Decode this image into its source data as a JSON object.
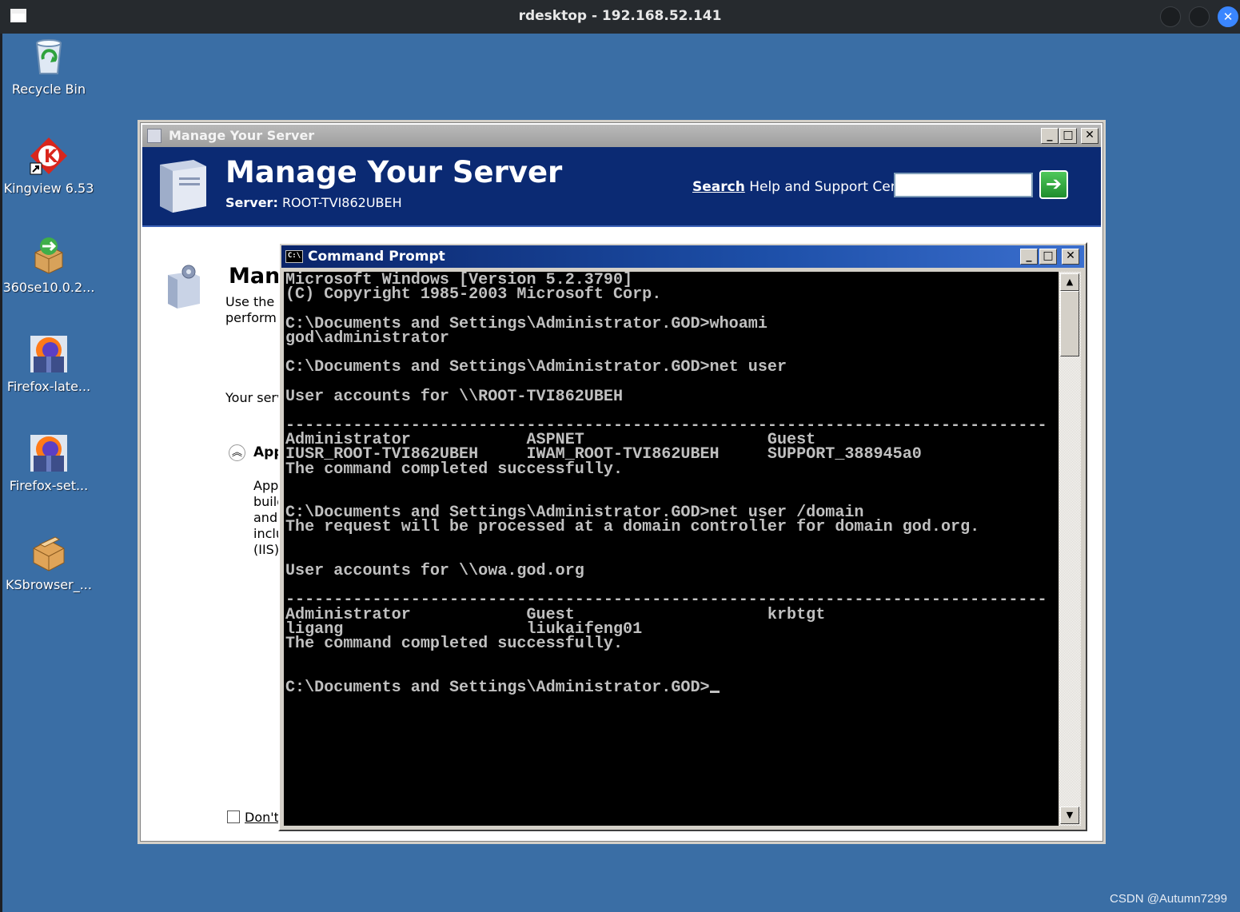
{
  "host": {
    "title": "rdesktop - 192.168.52.141",
    "close_glyph": "✕"
  },
  "desktop_icons": [
    {
      "label": "Recycle Bin",
      "icon": "recycle-bin-icon"
    },
    {
      "label": "Kingview 6.53",
      "icon": "kingview-icon"
    },
    {
      "label": "360se10.0.2...",
      "icon": "package-installer-icon"
    },
    {
      "label": "Firefox-late...",
      "icon": "firefox-installer-icon"
    },
    {
      "label": "Firefox-set...",
      "icon": "firefox-installer-icon"
    },
    {
      "label": "KSbrowser_...",
      "icon": "package-installer-icon"
    }
  ],
  "manage_server": {
    "window_title": "Manage Your Server",
    "heading": "Manage Your Server",
    "server_label": "Server:",
    "server_name": "ROOT-TVI862UBEH",
    "search_label_bold": "Search",
    "search_label_rest": " Help and Support Center",
    "search_value": "",
    "go_glyph": "➔",
    "content_heading": "Mana",
    "content_line1": "Use the t",
    "content_line2": "perform y",
    "your_server": "Your serv",
    "roles_heading": "App",
    "roles_lines": [
      "Appl",
      "build",
      "and",
      "inclu",
      "(IIS)"
    ],
    "dont_show": "Don't"
  },
  "cmd": {
    "window_title": "Command Prompt",
    "icon_text": "C:\\",
    "lines": [
      "Microsoft Windows [Version 5.2.3790]",
      "(C) Copyright 1985-2003 Microsoft Corp.",
      "",
      "C:\\Documents and Settings\\Administrator.GOD>whoami",
      "god\\administrator",
      "",
      "C:\\Documents and Settings\\Administrator.GOD>net user",
      "",
      "User accounts for \\\\ROOT-TVI862UBEH",
      "",
      "-------------------------------------------------------------------------------",
      "Administrator            ASPNET                   Guest",
      "IUSR_ROOT-TVI862UBEH     IWAM_ROOT-TVI862UBEH     SUPPORT_388945a0",
      "The command completed successfully.",
      "",
      "",
      "C:\\Documents and Settings\\Administrator.GOD>net user /domain",
      "The request will be processed at a domain controller for domain god.org.",
      "",
      "",
      "User accounts for \\\\owa.god.org",
      "",
      "-------------------------------------------------------------------------------",
      "Administrator            Guest                    krbtgt",
      "ligang                   liukaifeng01",
      "The command completed successfully.",
      "",
      "",
      "C:\\Documents and Settings\\Administrator.GOD>"
    ]
  },
  "window_buttons": {
    "minimize": "_",
    "maximize": "□",
    "close": "✕"
  },
  "watermark": "CSDN @Autumn7299"
}
